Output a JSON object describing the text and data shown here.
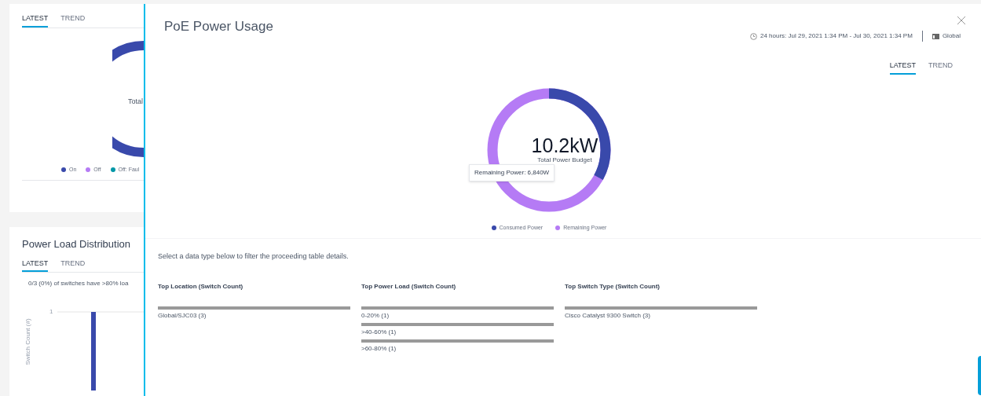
{
  "background": {
    "status_card": {
      "tabs": [
        {
          "label": "LATEST",
          "selected": true
        },
        {
          "label": "TREND",
          "selected": false
        }
      ],
      "center_label": "Total",
      "legend": [
        {
          "label": "On",
          "color": "#3949ab"
        },
        {
          "label": "Off",
          "color": "#b57bf5"
        },
        {
          "label": "Off: Faul",
          "color": "#0097a7"
        }
      ]
    },
    "load_card": {
      "title": "Power Load Distribution",
      "tabs": [
        {
          "label": "LATEST",
          "selected": true
        },
        {
          "label": "TREND",
          "selected": false
        }
      ],
      "summary": "0/3 (0%) of switches have >80% loa",
      "y_axis_label": "Switch Count (#)",
      "y_tick": "1"
    }
  },
  "drawer": {
    "title": "PoE Power Usage",
    "time_range": "24 hours: Jul 29, 2021 1:34 PM - Jul 30, 2021 1:34 PM",
    "location": "Global",
    "tabs": [
      {
        "label": "LATEST",
        "selected": true
      },
      {
        "label": "TREND",
        "selected": false
      }
    ],
    "donut": {
      "value": "10.2kW",
      "caption": "Total Power Budget",
      "level": 0.33,
      "tooltip": "Remaining Power: 6,840W",
      "legend": [
        {
          "label": "Consumed Power",
          "color": "#3949ab"
        },
        {
          "label": "Remaining Power",
          "color": "#b57bf5"
        }
      ]
    },
    "instruction": "Select a data type below to filter the proceeding table details.",
    "columns": [
      {
        "title": "Top Location (Switch Count)",
        "items": [
          {
            "label": "Global/SJC03 (3)"
          }
        ]
      },
      {
        "title": "Top Power Load (Switch Count)",
        "items": [
          {
            "label": "0-20% (1)"
          },
          {
            "label": ">40-60% (1)"
          },
          {
            "label": ">60-80% (1)"
          }
        ]
      },
      {
        "title": "Top Switch Type (Switch Count)",
        "items": [
          {
            "label": "Cisco Catalyst 9300 Switch (3)"
          }
        ]
      }
    ]
  }
}
